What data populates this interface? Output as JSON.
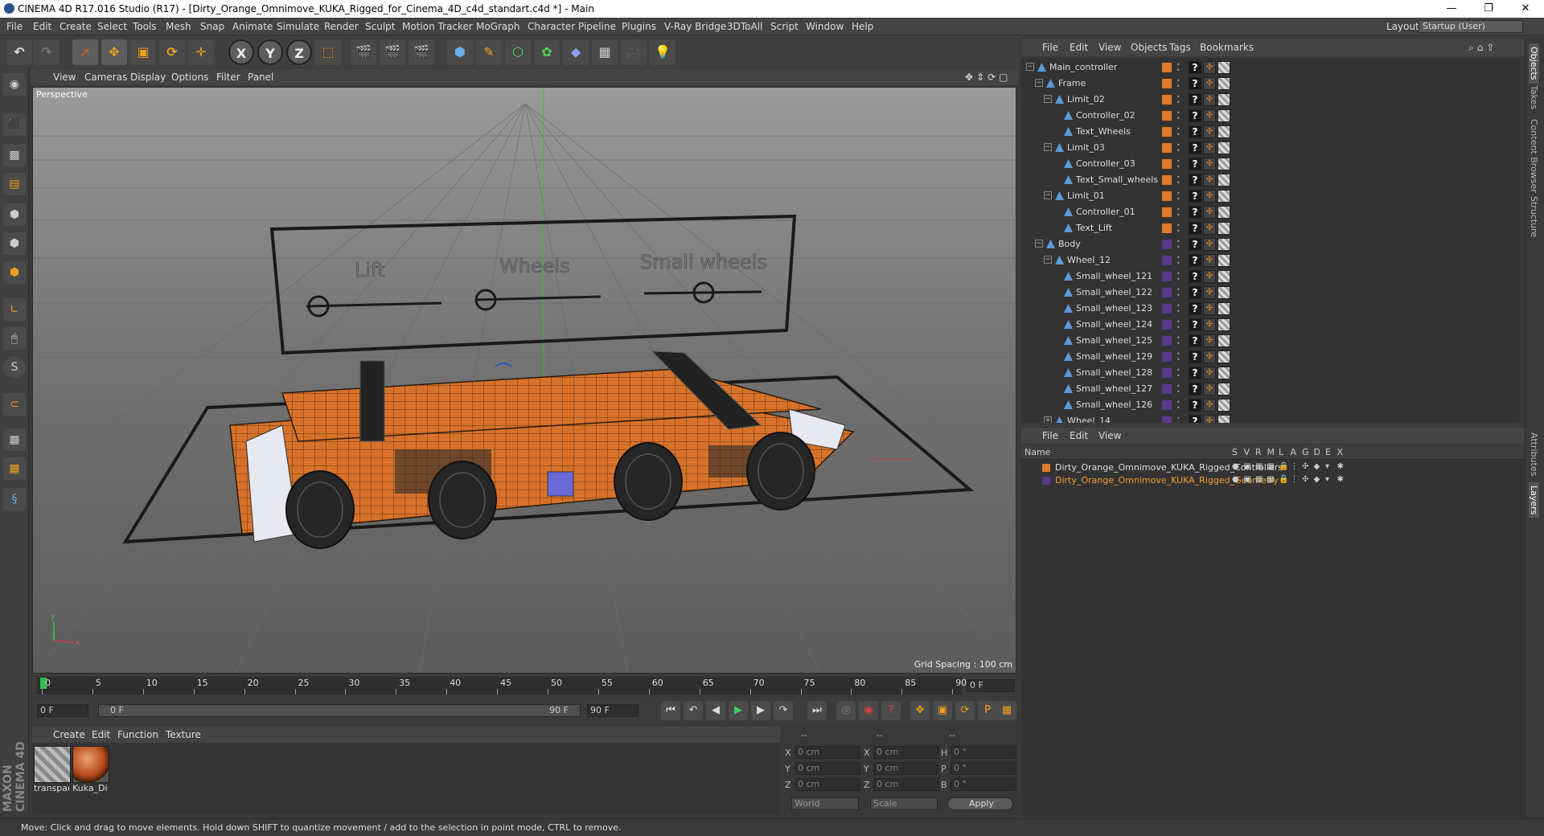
{
  "window": {
    "title": "CINEMA 4D R17.016 Studio (R17) - [Dirty_Orange_Omnimove_KUKA_Rigged_for_Cinema_4D_c4d_standart.c4d *] - Main",
    "controls": [
      "—",
      "❐",
      "✕"
    ]
  },
  "menubar": {
    "items": [
      "File",
      "Edit",
      "Create",
      "Select",
      "Tools",
      "Mesh",
      "Snap",
      "Animate",
      "Simulate",
      "Render",
      "Sculpt",
      "Motion Tracker",
      "MoGraph",
      "Character",
      "Pipeline",
      "Plugins",
      "V-Ray Bridge",
      "3DToAll",
      "Script",
      "Window",
      "Help"
    ],
    "layout_label": "Layout:",
    "layout_value": "Startup (User)"
  },
  "toolbar": {
    "axis_x": "X",
    "axis_y": "Y",
    "axis_z": "Z"
  },
  "viewport": {
    "menu": [
      "View",
      "Cameras",
      "Display",
      "Options",
      "Filter",
      "Panel"
    ],
    "label": "Perspective",
    "grid_spacing": "Grid Spacing : 100 cm",
    "slider_labels": [
      "Lift",
      "Wheels",
      "Small wheels"
    ],
    "axis_labels": {
      "y": "y",
      "x": "x"
    }
  },
  "timeline": {
    "ticks": [
      "0",
      "5",
      "10",
      "15",
      "20",
      "25",
      "30",
      "35",
      "40",
      "45",
      "50",
      "55",
      "60",
      "65",
      "70",
      "75",
      "80",
      "85",
      "90"
    ],
    "current_frame": "0 F",
    "start_field": "0 F",
    "range_start": "0 F",
    "range_end": "90 F",
    "end_field": "90 F"
  },
  "material_manager": {
    "menu": [
      "Create",
      "Edit",
      "Function",
      "Texture"
    ],
    "materials": [
      {
        "name": "transpar"
      },
      {
        "name": "Kuka_Di"
      }
    ]
  },
  "coordinates": {
    "headers": [
      "--",
      "--",
      "--"
    ],
    "rows": [
      {
        "a": "X",
        "av": "0 cm",
        "b": "X",
        "bv": "0 cm",
        "c": "H",
        "cv": "0 °"
      },
      {
        "a": "Y",
        "av": "0 cm",
        "b": "Y",
        "bv": "0 cm",
        "c": "P",
        "cv": "0 °"
      },
      {
        "a": "Z",
        "av": "0 cm",
        "b": "Z",
        "bv": "0 cm",
        "c": "B",
        "cv": "0 °"
      }
    ],
    "mode_world": "World",
    "mode_scale": "Scale",
    "apply": "Apply"
  },
  "status": {
    "text": "Move: Click and drag to move elements. Hold down SHIFT to quantize movement / add to the selection in point mode, CTRL to remove."
  },
  "object_manager": {
    "menu": [
      "File",
      "Edit",
      "View",
      "Objects",
      "Tags",
      "Bookmarks"
    ],
    "objects": [
      {
        "name": "Main_controller",
        "depth": 0,
        "expand": "−",
        "layer": "#e07b2a"
      },
      {
        "name": "Frame",
        "depth": 1,
        "expand": "−",
        "layer": "#e07b2a"
      },
      {
        "name": "Limit_02",
        "depth": 2,
        "expand": "−",
        "layer": "#e07b2a"
      },
      {
        "name": "Controller_02",
        "depth": 3,
        "expand": "",
        "layer": "#e07b2a"
      },
      {
        "name": "Text_Wheels",
        "depth": 3,
        "expand": "",
        "layer": "#e07b2a"
      },
      {
        "name": "Limit_03",
        "depth": 2,
        "expand": "−",
        "layer": "#e07b2a"
      },
      {
        "name": "Controller_03",
        "depth": 3,
        "expand": "",
        "layer": "#e07b2a"
      },
      {
        "name": "Text_Small_wheels",
        "depth": 3,
        "expand": "",
        "layer": "#e07b2a"
      },
      {
        "name": "Limit_01",
        "depth": 2,
        "expand": "−",
        "layer": "#e07b2a"
      },
      {
        "name": "Controller_01",
        "depth": 3,
        "expand": "",
        "layer": "#e07b2a"
      },
      {
        "name": "Text_Lift",
        "depth": 3,
        "expand": "",
        "layer": "#e07b2a"
      },
      {
        "name": "Body",
        "depth": 1,
        "expand": "−",
        "layer": "#5a3a8a"
      },
      {
        "name": "Wheel_12",
        "depth": 2,
        "expand": "−",
        "layer": "#5a3a8a"
      },
      {
        "name": "Small_wheel_121",
        "depth": 3,
        "expand": "",
        "layer": "#5a3a8a"
      },
      {
        "name": "Small_wheel_122",
        "depth": 3,
        "expand": "",
        "layer": "#5a3a8a"
      },
      {
        "name": "Small_wheel_123",
        "depth": 3,
        "expand": "",
        "layer": "#5a3a8a"
      },
      {
        "name": "Small_wheel_124",
        "depth": 3,
        "expand": "",
        "layer": "#5a3a8a"
      },
      {
        "name": "Small_wheel_125",
        "depth": 3,
        "expand": "",
        "layer": "#5a3a8a"
      },
      {
        "name": "Small_wheel_129",
        "depth": 3,
        "expand": "",
        "layer": "#5a3a8a"
      },
      {
        "name": "Small_wheel_128",
        "depth": 3,
        "expand": "",
        "layer": "#5a3a8a"
      },
      {
        "name": "Small_wheel_127",
        "depth": 3,
        "expand": "",
        "layer": "#5a3a8a"
      },
      {
        "name": "Small_wheel_126",
        "depth": 3,
        "expand": "",
        "layer": "#5a3a8a"
      },
      {
        "name": "Wheel_14",
        "depth": 2,
        "expand": "+",
        "layer": "#5a3a8a"
      }
    ]
  },
  "layer_manager": {
    "menu": [
      "File",
      "Edit",
      "View"
    ],
    "columns": [
      "Name",
      "S",
      "V",
      "R",
      "M",
      "L",
      "A",
      "G",
      "D",
      "E",
      "X"
    ],
    "layers": [
      {
        "name": "Dirty_Orange_Omnimove_KUKA_Rigged_Controllers",
        "color": "#e07b2a",
        "text_color": "#dddddd"
      },
      {
        "name": "Dirty_Orange_Omnimove_KUKA_Rigged_Geometry",
        "color": "#5a3a8a",
        "text_color": "#f0a030"
      }
    ]
  },
  "right_tabs": [
    "Objects",
    "Takes",
    "Content Browser",
    "Structure",
    "Attributes",
    "Layers"
  ],
  "brand": "MAXON CINEMA 4D"
}
